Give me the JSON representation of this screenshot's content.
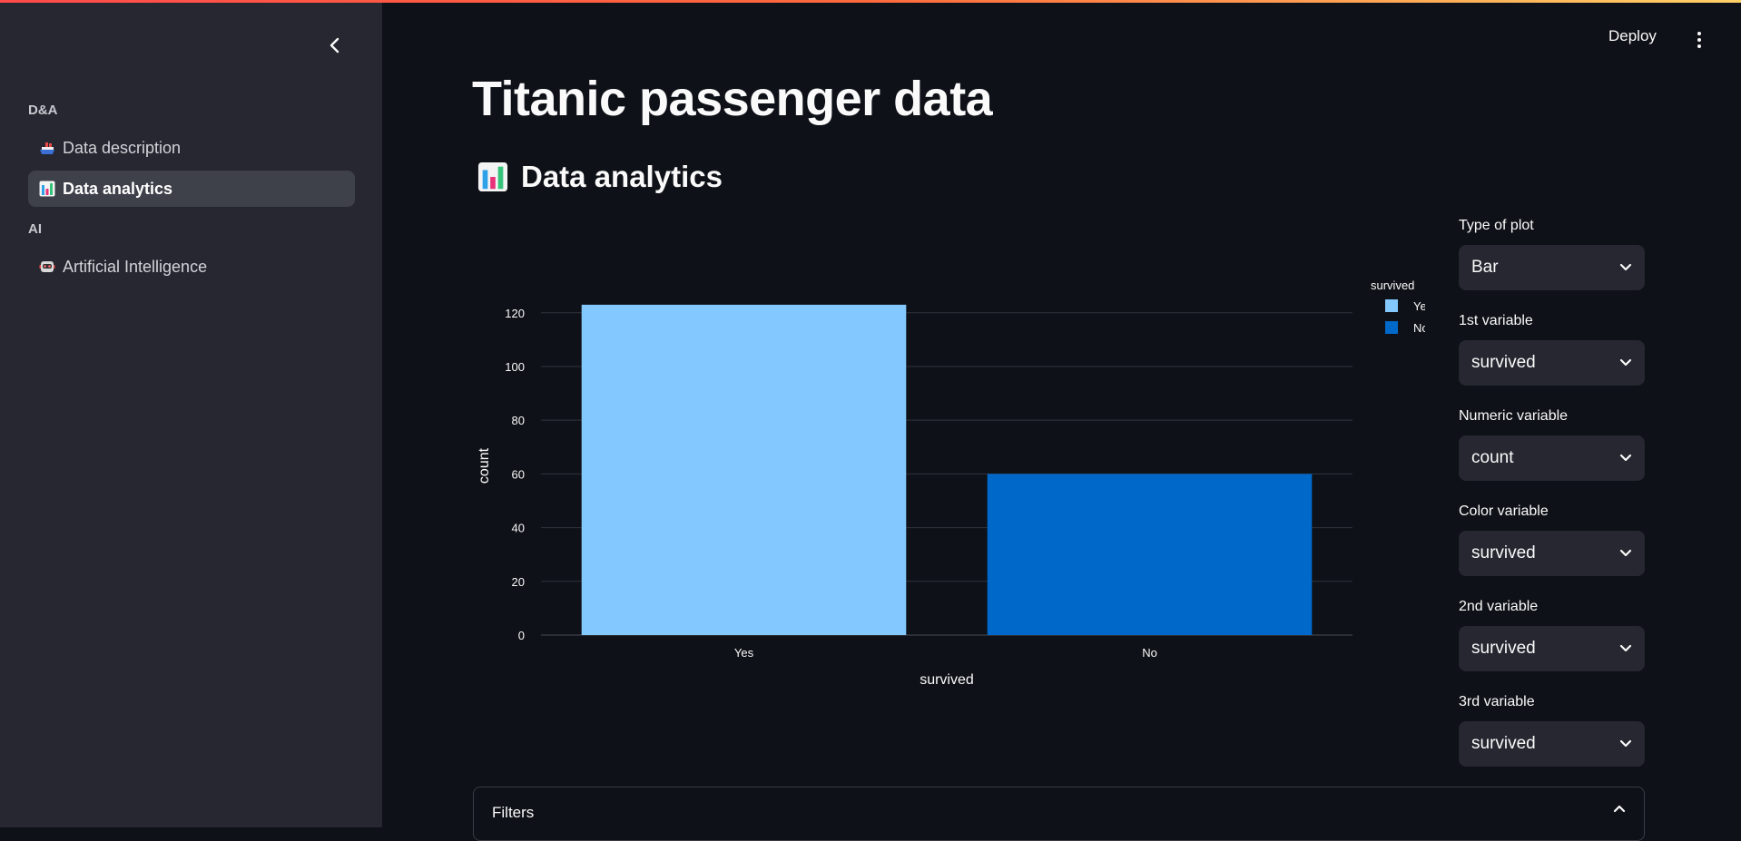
{
  "sidebar": {
    "sections": [
      {
        "label": "D&A"
      },
      {
        "label": "AI"
      }
    ],
    "items": [
      {
        "label": "Data description",
        "icon": "ship-icon"
      },
      {
        "label": "Data analytics",
        "icon": "bar-chart-icon",
        "active": true
      },
      {
        "label": "Artificial Intelligence",
        "icon": "robot-icon"
      }
    ]
  },
  "header": {
    "deploy_label": "Deploy"
  },
  "main": {
    "title": "Titanic passenger data",
    "section_title": "Data analytics"
  },
  "controls": [
    {
      "label": "Type of plot",
      "value": "Bar"
    },
    {
      "label": "1st variable",
      "value": "survived"
    },
    {
      "label": "Numeric variable",
      "value": "count"
    },
    {
      "label": "Color variable",
      "value": "survived"
    },
    {
      "label": "2nd variable",
      "value": "survived"
    },
    {
      "label": "3rd variable",
      "value": "survived"
    }
  ],
  "filters": {
    "label": "Filters"
  },
  "colors": {
    "accent": "#ff4b4b",
    "yes_bar": "#83c9ff",
    "no_bar": "#0068c9"
  },
  "chart_data": {
    "type": "bar",
    "categories": [
      "Yes",
      "No"
    ],
    "series": [
      {
        "name": "Yes",
        "values": [
          123,
          null
        ],
        "color": "#83c9ff"
      },
      {
        "name": "No",
        "values": [
          null,
          60
        ],
        "color": "#0068c9"
      }
    ],
    "xlabel": "survived",
    "ylabel": "count",
    "ylim": [
      0,
      126
    ],
    "yticks": [
      0,
      20,
      40,
      60,
      80,
      100,
      120
    ],
    "legend_title": "survived",
    "legend_position": "top-right",
    "grid": true
  }
}
